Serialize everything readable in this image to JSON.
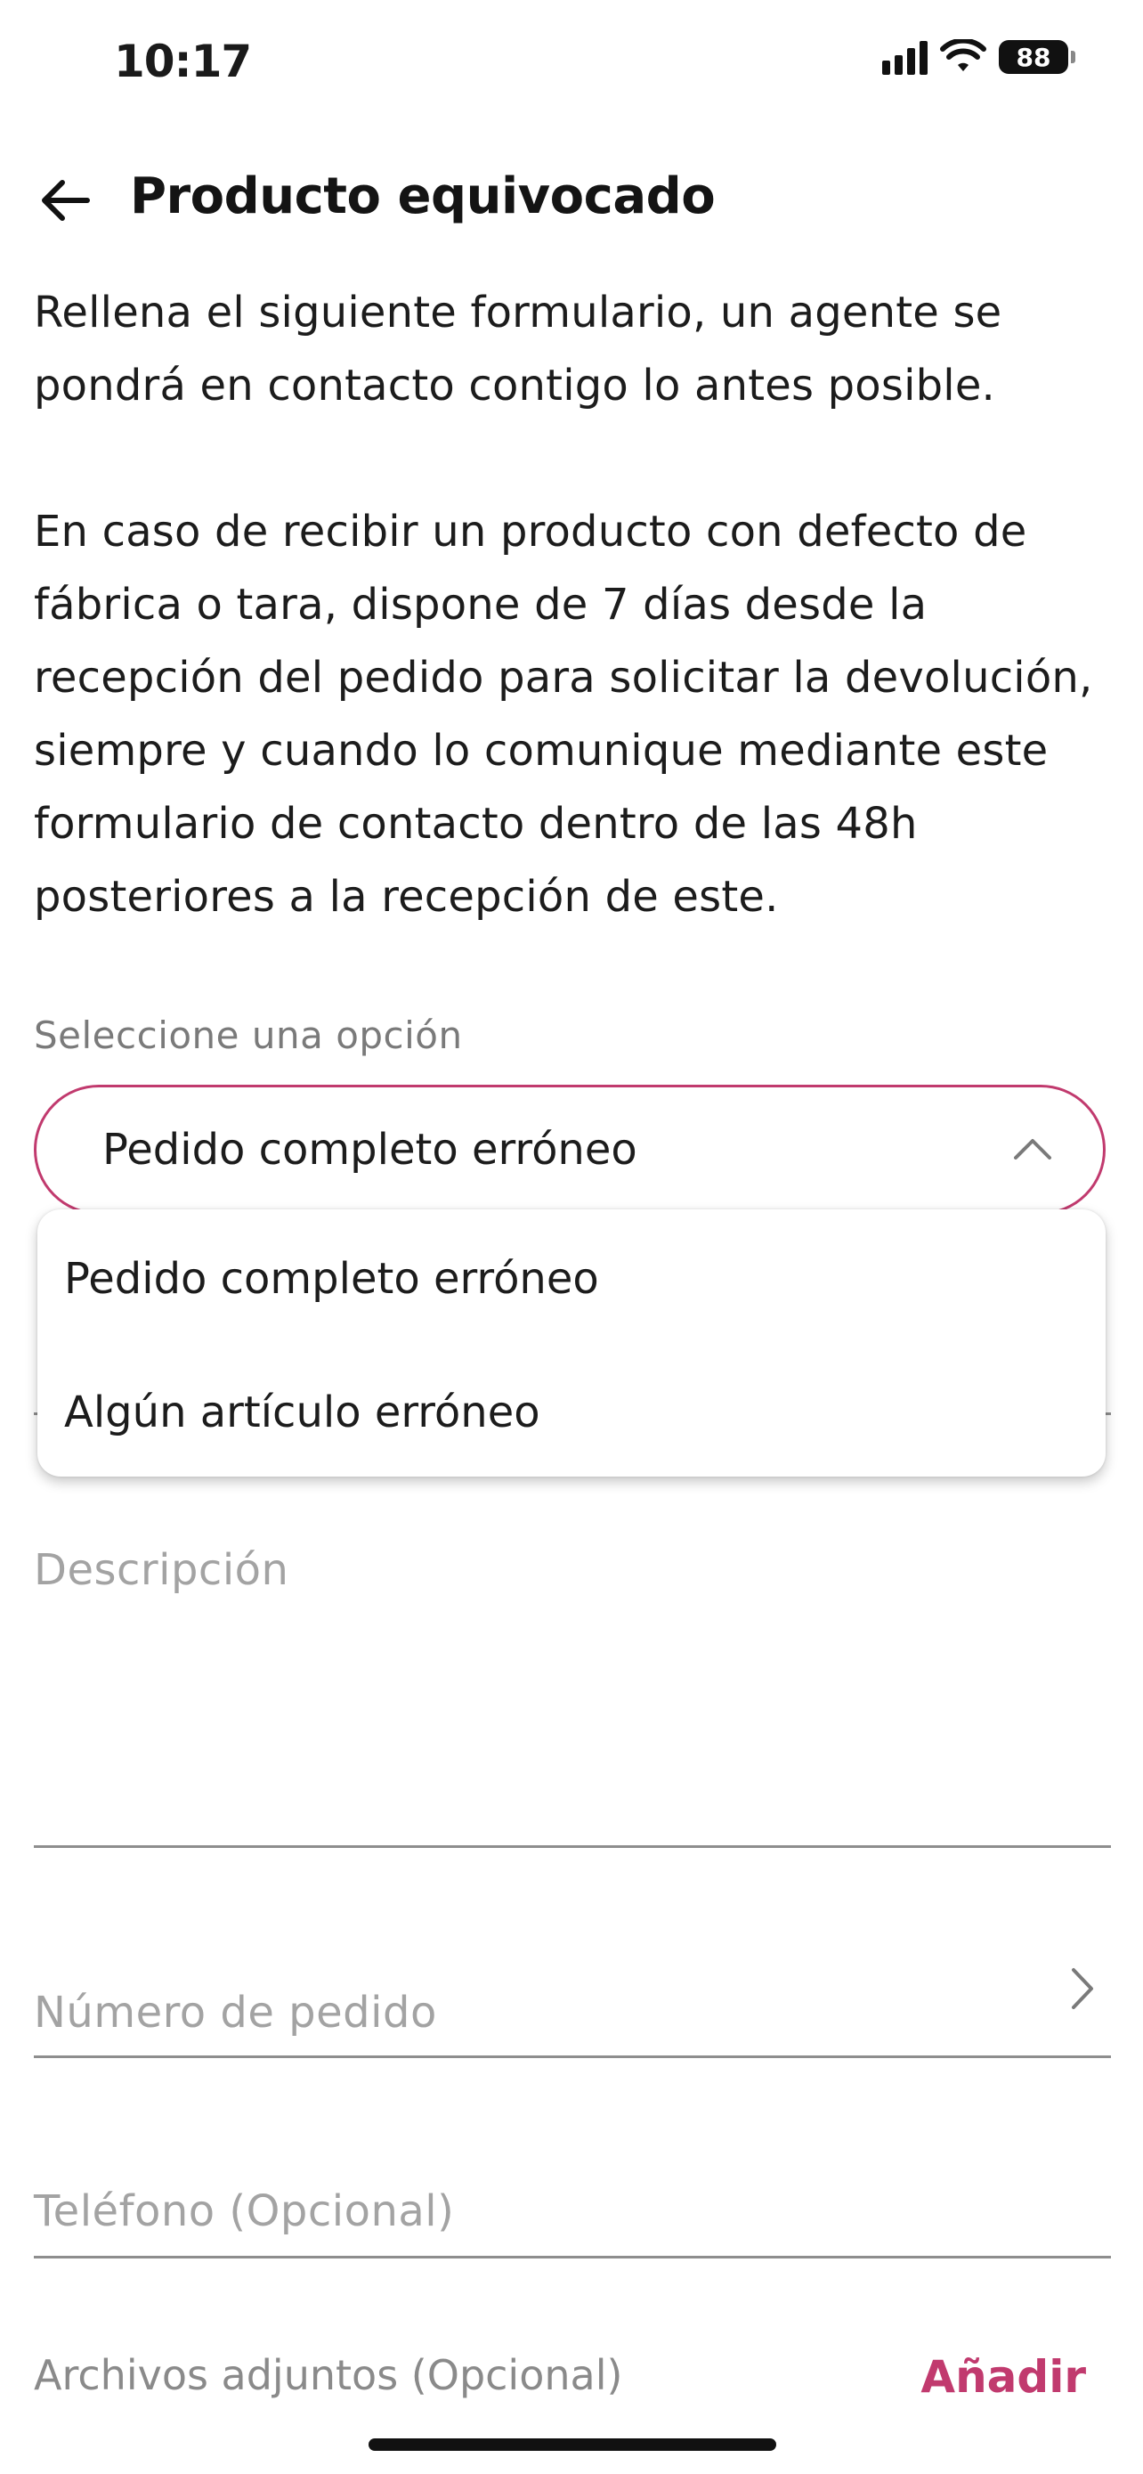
{
  "status_bar": {
    "time": "10:17",
    "battery": "88"
  },
  "header": {
    "title": "Producto equivocado"
  },
  "intro": {
    "paragraph1": "Rellena el siguiente formulario, un agente se pondrá en contacto contigo lo antes posible.",
    "paragraph2": "En caso de recibir un producto con defecto de fábrica o tara, dispone de 7 días desde la recepción del pedido para solicitar la devolución, siempre y cuando lo comunique mediante este formulario de contacto dentro de las 48h posteriores a la recepción de este."
  },
  "form": {
    "select_label": "Seleccione una opción",
    "select_value": "Pedido completo erróneo",
    "options": [
      "Pedido completo erróneo",
      "Algún artículo erróneo"
    ],
    "description_placeholder": "Descripción",
    "order_number_placeholder": "Número de pedido",
    "phone_placeholder": "Teléfono (Opcional)",
    "attachments_label": "Archivos adjuntos (Opcional)",
    "add_label": "Añadir"
  },
  "colors": {
    "accent": "#c13a6e"
  },
  "icons": [
    "back-arrow-icon",
    "chevron-up-icon",
    "chevron-right-icon",
    "signal-icon",
    "wifi-icon",
    "battery-icon"
  ]
}
